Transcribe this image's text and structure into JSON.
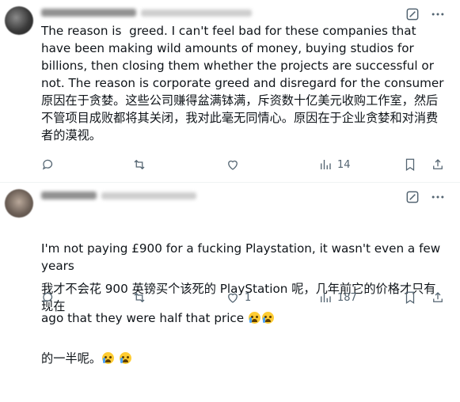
{
  "post1": {
    "english": "The reason is  greed. I can't feel bad for these companies that have been making wild amounts of money, buying studios for billions, then closing them whether the projects are successful or not. The reason is corporate greed and disregard for the consumer",
    "chinese": "原因在于贪婪。这些公司赚得盆满钵满，斥资数十亿美元收购工作室，然后不管项目成败都将其关闭，我对此毫无同情心。原因在于企业贪婪和对消费者的漠视。",
    "views": "14"
  },
  "post2": {
    "english_line1": "I'm not paying £900 for a fucking Playstation, it wasn't even a few years",
    "english_line2": "ago that they were half that price ",
    "chinese_line1": "我才不会花 900 英镑买个该死的 PlayStation 呢，几年前它的价格才只有现在",
    "chinese_line2": "的一半呢。",
    "likes": "1",
    "views": "187"
  },
  "icons": {
    "grok": "grok-icon",
    "more": "more-icon",
    "reply": "reply-icon",
    "retweet": "retweet-icon",
    "like": "like-icon",
    "views": "views-icon",
    "bookmark": "bookmark-icon",
    "share": "share-icon"
  },
  "colors": {
    "text": "#0f1419",
    "muted": "#536471"
  }
}
